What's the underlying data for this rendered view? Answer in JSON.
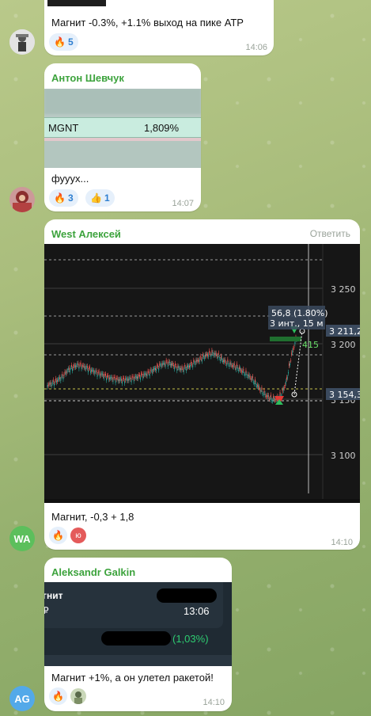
{
  "msg1": {
    "text": "Магнит -0.3%, +1.1% выход на пике АТР",
    "reaction_emoji": "🔥",
    "reaction_count": "5",
    "time": "14:06"
  },
  "msg2": {
    "author": "Антон Шевчук",
    "ticker": "MGNT",
    "percent": "1,809%",
    "text": "фууух...",
    "reactions": [
      {
        "emoji": "🔥",
        "count": "3"
      },
      {
        "emoji": "👍",
        "count": "1"
      }
    ],
    "time": "14:07"
  },
  "msg3": {
    "author": "West Алексей",
    "reply_label": "Ответить",
    "text": "Магнит, -0,3 + 1,8",
    "time": "14:10",
    "avatar_initials": "WA",
    "reactions": [
      {
        "emoji": "🔥"
      },
      {
        "emoji": "ю"
      }
    ],
    "chart": {
      "measure_line1": "56,8 (1.80%)",
      "measure_line2": "3 инт., 15 м",
      "price_label_current": "3 211,2",
      "price_label_low": "3 154,3",
      "side_value": "415",
      "y_ticks": [
        "3 250",
        "3 200",
        "3 150",
        "3 100"
      ]
    }
  },
  "msg4": {
    "author": "Aleksandr Galkin",
    "inner_title": "гнит",
    "inner_sub": "₽",
    "inner_time": "13:06",
    "inner_percent": "(1,03%)",
    "text": "Магнит +1%, а он улетел ракетой!",
    "time": "14:10",
    "avatar_initials": "AG",
    "reactions": [
      {
        "emoji": "🔥"
      }
    ]
  },
  "colors": {
    "author_green": "#3da33d",
    "avatar_wa": "#5cbf5c",
    "avatar_ag": "#53a9e9",
    "candle_up": "#26a69a",
    "candle_down": "#ef5350",
    "chart_bg": "#161616"
  }
}
